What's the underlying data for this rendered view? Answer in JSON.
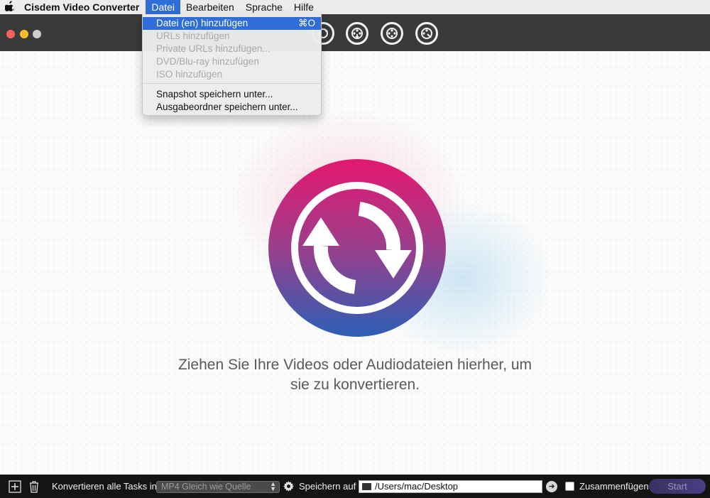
{
  "menubar": {
    "app_name": "Cisdem Video Converter",
    "items": [
      "Datei",
      "Bearbeiten",
      "Sprache",
      "Hilfe"
    ],
    "active_item": "Datei"
  },
  "dropdown": {
    "items": [
      {
        "label": "Datei (en) hinzufügen",
        "shortcut": "⌘O",
        "enabled": true,
        "highlighted": true
      },
      {
        "label": "URLs hinzufügen",
        "enabled": false
      },
      {
        "label": "Private URLs hinzufügen...",
        "enabled": false
      },
      {
        "label": "DVD/Blu-ray hinzufügen",
        "enabled": false
      },
      {
        "label": "ISO hinzufügen",
        "enabled": false
      },
      {
        "label": "Snapshot speichern unter...",
        "enabled": true
      },
      {
        "label": "Ausgabeordner speichern unter...",
        "enabled": true
      }
    ]
  },
  "main": {
    "drop_text_line1": "Ziehen Sie Ihre Videos oder Audiodateien hierher, um",
    "drop_text_line2": "sie zu konvertieren."
  },
  "bottombar": {
    "convert_label": "Konvertieren alle Tasks in",
    "format_value": "MP4 Gleich wie Quelle",
    "save_label": "Speichern auf",
    "path_value": "/Users/mac/Desktop",
    "merge_label": "Zusammenfügen",
    "merge_checked": false,
    "start_label": "Start"
  },
  "colors": {
    "accent": "#2f6ed9",
    "toolbar": "#3a3a3a",
    "logo_top": "#e5176f",
    "logo_bottom": "#2c5fb5",
    "bottombar": "#141414"
  }
}
